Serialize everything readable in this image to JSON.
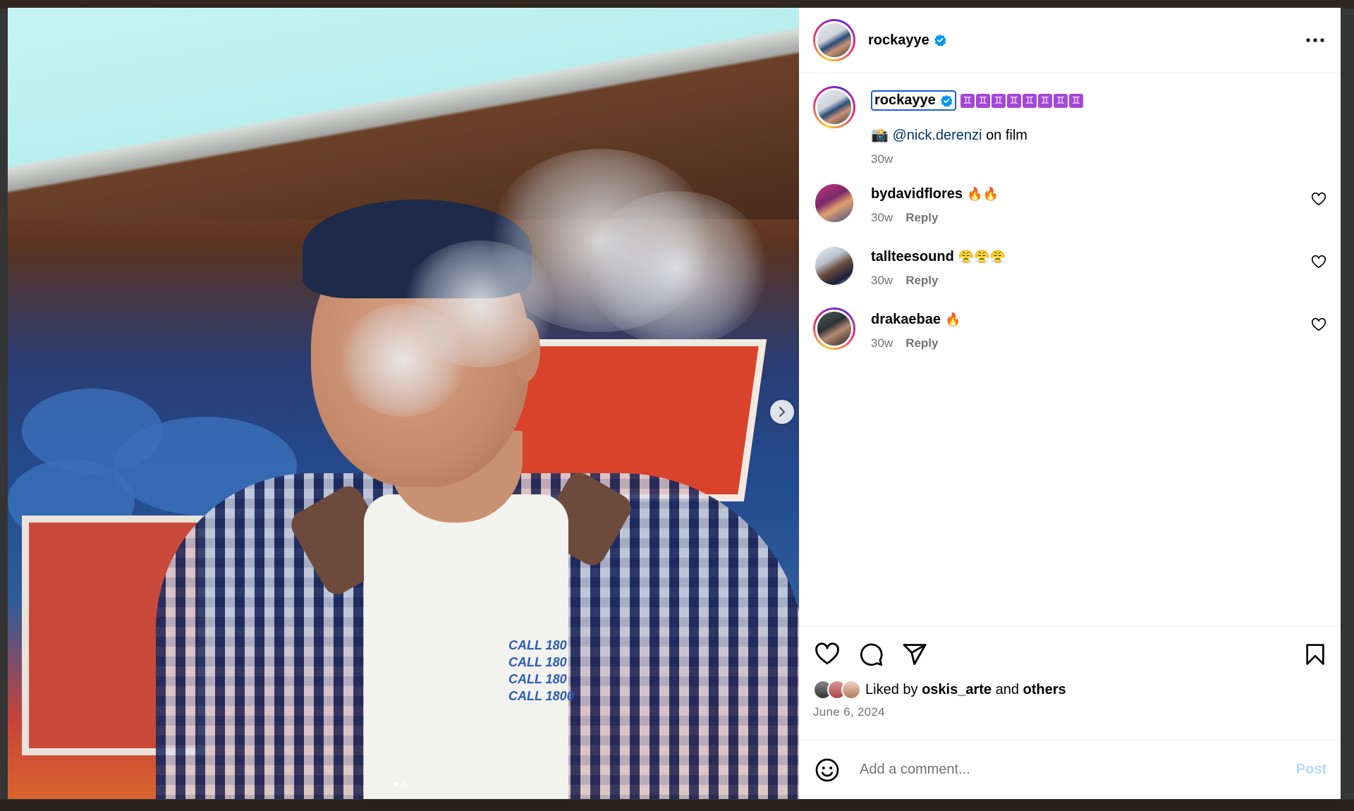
{
  "post": {
    "username": "rockayye",
    "verified": true,
    "caption_symbols": [
      "♊",
      "♊",
      "♊",
      "♊",
      "♊",
      "♊",
      "♊",
      "♊"
    ],
    "caption_camera": "📸",
    "caption_mention": "@nick.derenzi",
    "caption_rest": "on film",
    "caption_time": "30w",
    "image_pages": 2,
    "image_current_page": 1
  },
  "comments": [
    {
      "username": "bydavidflores",
      "text": "🔥🔥",
      "time": "30w",
      "reply_label": "Reply",
      "story_ring": false
    },
    {
      "username": "tallteesound",
      "text": "😤😤😤",
      "time": "30w",
      "reply_label": "Reply",
      "story_ring": false
    },
    {
      "username": "drakaebae",
      "text": "🔥",
      "time": "30w",
      "reply_label": "Reply",
      "story_ring": true
    }
  ],
  "likes": {
    "prefix": "Liked by",
    "user": "oskis_arte",
    "and": "and",
    "others": "others"
  },
  "date": "June 6, 2024",
  "comment_box": {
    "placeholder": "Add a comment...",
    "post_label": "Post"
  },
  "photo_text": [
    "CALL 180",
    "CALL 180",
    "CALL 180",
    "CALL 1800"
  ],
  "colors": {
    "accent_blue": "#0095f6",
    "mention": "#00376b",
    "secondary_text": "#737373",
    "post_disabled": "#b3dbff"
  },
  "icons": {
    "more": "more-horizontal-icon",
    "heart": "heart-icon",
    "comment": "comment-icon",
    "share": "share-icon",
    "save": "bookmark-icon",
    "emoji": "emoji-icon",
    "next": "chevron-right-icon",
    "verified": "verified-badge-icon"
  }
}
